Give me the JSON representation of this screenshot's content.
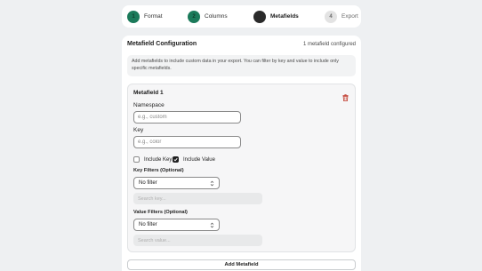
{
  "stepper": {
    "steps": [
      {
        "number": "1",
        "label": "Format",
        "state": "done"
      },
      {
        "number": "2",
        "label": "Columns",
        "state": "done"
      },
      {
        "number": "3",
        "label": "Metafields",
        "state": "current"
      },
      {
        "number": "4",
        "label": "Export",
        "state": "upcoming"
      }
    ]
  },
  "config": {
    "title": "Metafield Configuration",
    "count_text": "1 metafield configured",
    "info": "Add metafields to include custom data in your export. You can filter by key and value to include only specific metafields."
  },
  "metafield": {
    "title": "Metafield 1",
    "namespace_label": "Namespace",
    "namespace_placeholder": "e.g., custom",
    "namespace_value": "",
    "key_label": "Key",
    "key_placeholder": "e.g., color",
    "key_value": "",
    "include_key_label": "Include Key",
    "include_key_checked": false,
    "include_value_label": "Include Value",
    "include_value_checked": true,
    "key_filters_label": "Key Filters (Optional)",
    "key_filter_selected": "No filter",
    "search_key_placeholder": "Search key...",
    "value_filters_label": "Value Filters (Optional)",
    "value_filter_selected": "No filter",
    "search_value_placeholder": "Search value..."
  },
  "actions": {
    "add_label": "Add Metafield"
  },
  "colors": {
    "step_done": "#1b7a5a",
    "step_current": "#2a2a2a",
    "delete_icon": "#c0392b"
  }
}
